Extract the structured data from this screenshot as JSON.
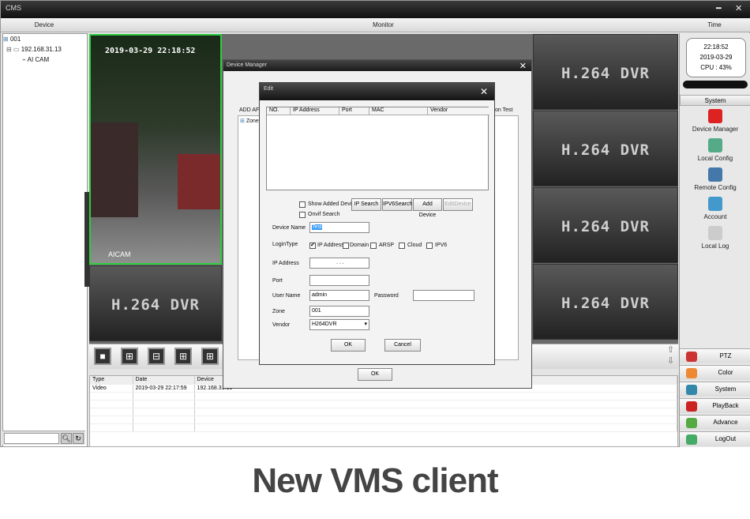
{
  "window": {
    "title": "CMS",
    "minimize": "━",
    "close": "✕"
  },
  "headers": {
    "device": "Device",
    "monitor": "Monitor",
    "time": "Time"
  },
  "tree": [
    "001",
    "192.168.31.13",
    "AI CAM"
  ],
  "camera": {
    "timestamp": "2019-03-29  22:18:52",
    "name": "AICAM"
  },
  "dvr_label": "H.264 DVR",
  "right": {
    "clock": {
      "time": "22:18:52",
      "date": "2019-03-29",
      "cpu": "CPU : 43%"
    },
    "system_header": "System",
    "system_items": [
      {
        "label": "Device Manager",
        "icon": "device-manager-icon",
        "color": "#d22"
      },
      {
        "label": "Local Config",
        "icon": "local-config-icon",
        "color": "#5a8"
      },
      {
        "label": "Remote Config",
        "icon": "remote-config-icon",
        "color": "#47a"
      },
      {
        "label": "Account",
        "icon": "account-icon",
        "color": "#49c"
      },
      {
        "label": "Local Log",
        "icon": "local-log-icon",
        "color": "#ccc"
      }
    ],
    "bottom_items": [
      {
        "label": "PTZ",
        "icon": "ptz-icon",
        "color": "#c33"
      },
      {
        "label": "Color",
        "icon": "color-icon",
        "color": "#e83"
      },
      {
        "label": "System",
        "icon": "system-icon",
        "color": "#38a"
      },
      {
        "label": "PlayBack",
        "icon": "playback-icon",
        "color": "#c22"
      },
      {
        "label": "Advance",
        "icon": "advance-icon",
        "color": "#5a4"
      },
      {
        "label": "LogOut",
        "icon": "logout-icon",
        "color": "#4a6"
      }
    ]
  },
  "log": {
    "columns": [
      "Type",
      "Date",
      "Device"
    ],
    "rows": [
      [
        "Video",
        "2019-03-29 22:17:59",
        "192.168.31.13"
      ]
    ]
  },
  "device_manager": {
    "title": "Device Manager",
    "add_label": "ADD AF",
    "tree_zone": "Zone",
    "connection_test": "on Test",
    "ok": "OK"
  },
  "edit": {
    "title": "Edit",
    "columns": [
      "NO.",
      "IP Address",
      "Port",
      "MAC",
      "Vendor"
    ],
    "show_added": "Show Added Devic",
    "onvif_search": "Onvif Search",
    "buttons": {
      "ip_search": "IP Search",
      "ipv6_search": "IPV6Search",
      "add_device": "Add Device",
      "edit_device": "EditDevice"
    },
    "device_name_label": "Device Name",
    "device_name": "Test",
    "login_type_label": "LoginType",
    "login_types": [
      "IP Address",
      "Domain",
      "ARSP",
      "Cloud",
      "IPV6"
    ],
    "ip_label": "IP Address",
    "ip_value": ".       .       .",
    "port_label": "Port",
    "user_label": "User Name",
    "user_value": "admin",
    "password_label": "Password",
    "zone_label": "Zone",
    "zone_value": "001",
    "vendor_label": "Vendor",
    "vendor_value": "H264DVR",
    "ok": "OK",
    "cancel": "Cancel"
  },
  "caption": "New VMS client"
}
